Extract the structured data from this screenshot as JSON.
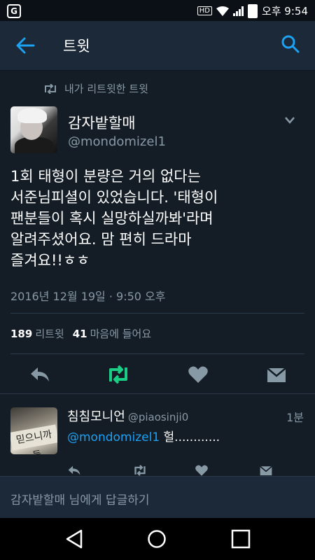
{
  "status_bar": {
    "hd": "HD",
    "time": "오후 9:54"
  },
  "app_bar": {
    "title": "트윗"
  },
  "retweet_context": "내가 리트윗한 트윗",
  "tweet": {
    "display_name": "감자밭할매",
    "handle": "@mondomizel1",
    "text": "1회 태형이 분량은 거의 없다는\n서준님피셜이 있었습니다. '태형이\n팬분들이 혹시 실망하실까봐'라며\n알려주셨어요. 맘 편히 드라마\n즐겨요!!ㅎㅎ",
    "timestamp": "2016년 12월 19일 · 9:50 오후",
    "retweets_count": "189",
    "retweets_label": "리트윗",
    "likes_count": "41",
    "likes_label": "마음에 들어요"
  },
  "reply": {
    "display_name": "침침모니언",
    "handle": "@piaosinji0",
    "time": "1분",
    "mention": "@mondomizel1",
    "text": " 헐............",
    "avatar_text": "믿으니까 둘"
  },
  "composer": {
    "placeholder": "감자밭할매 님에게 답글하기"
  },
  "colors": {
    "background": "#141d26",
    "accent": "#1da1f2",
    "retweet_active": "#19cf86",
    "muted": "#8899a6"
  }
}
